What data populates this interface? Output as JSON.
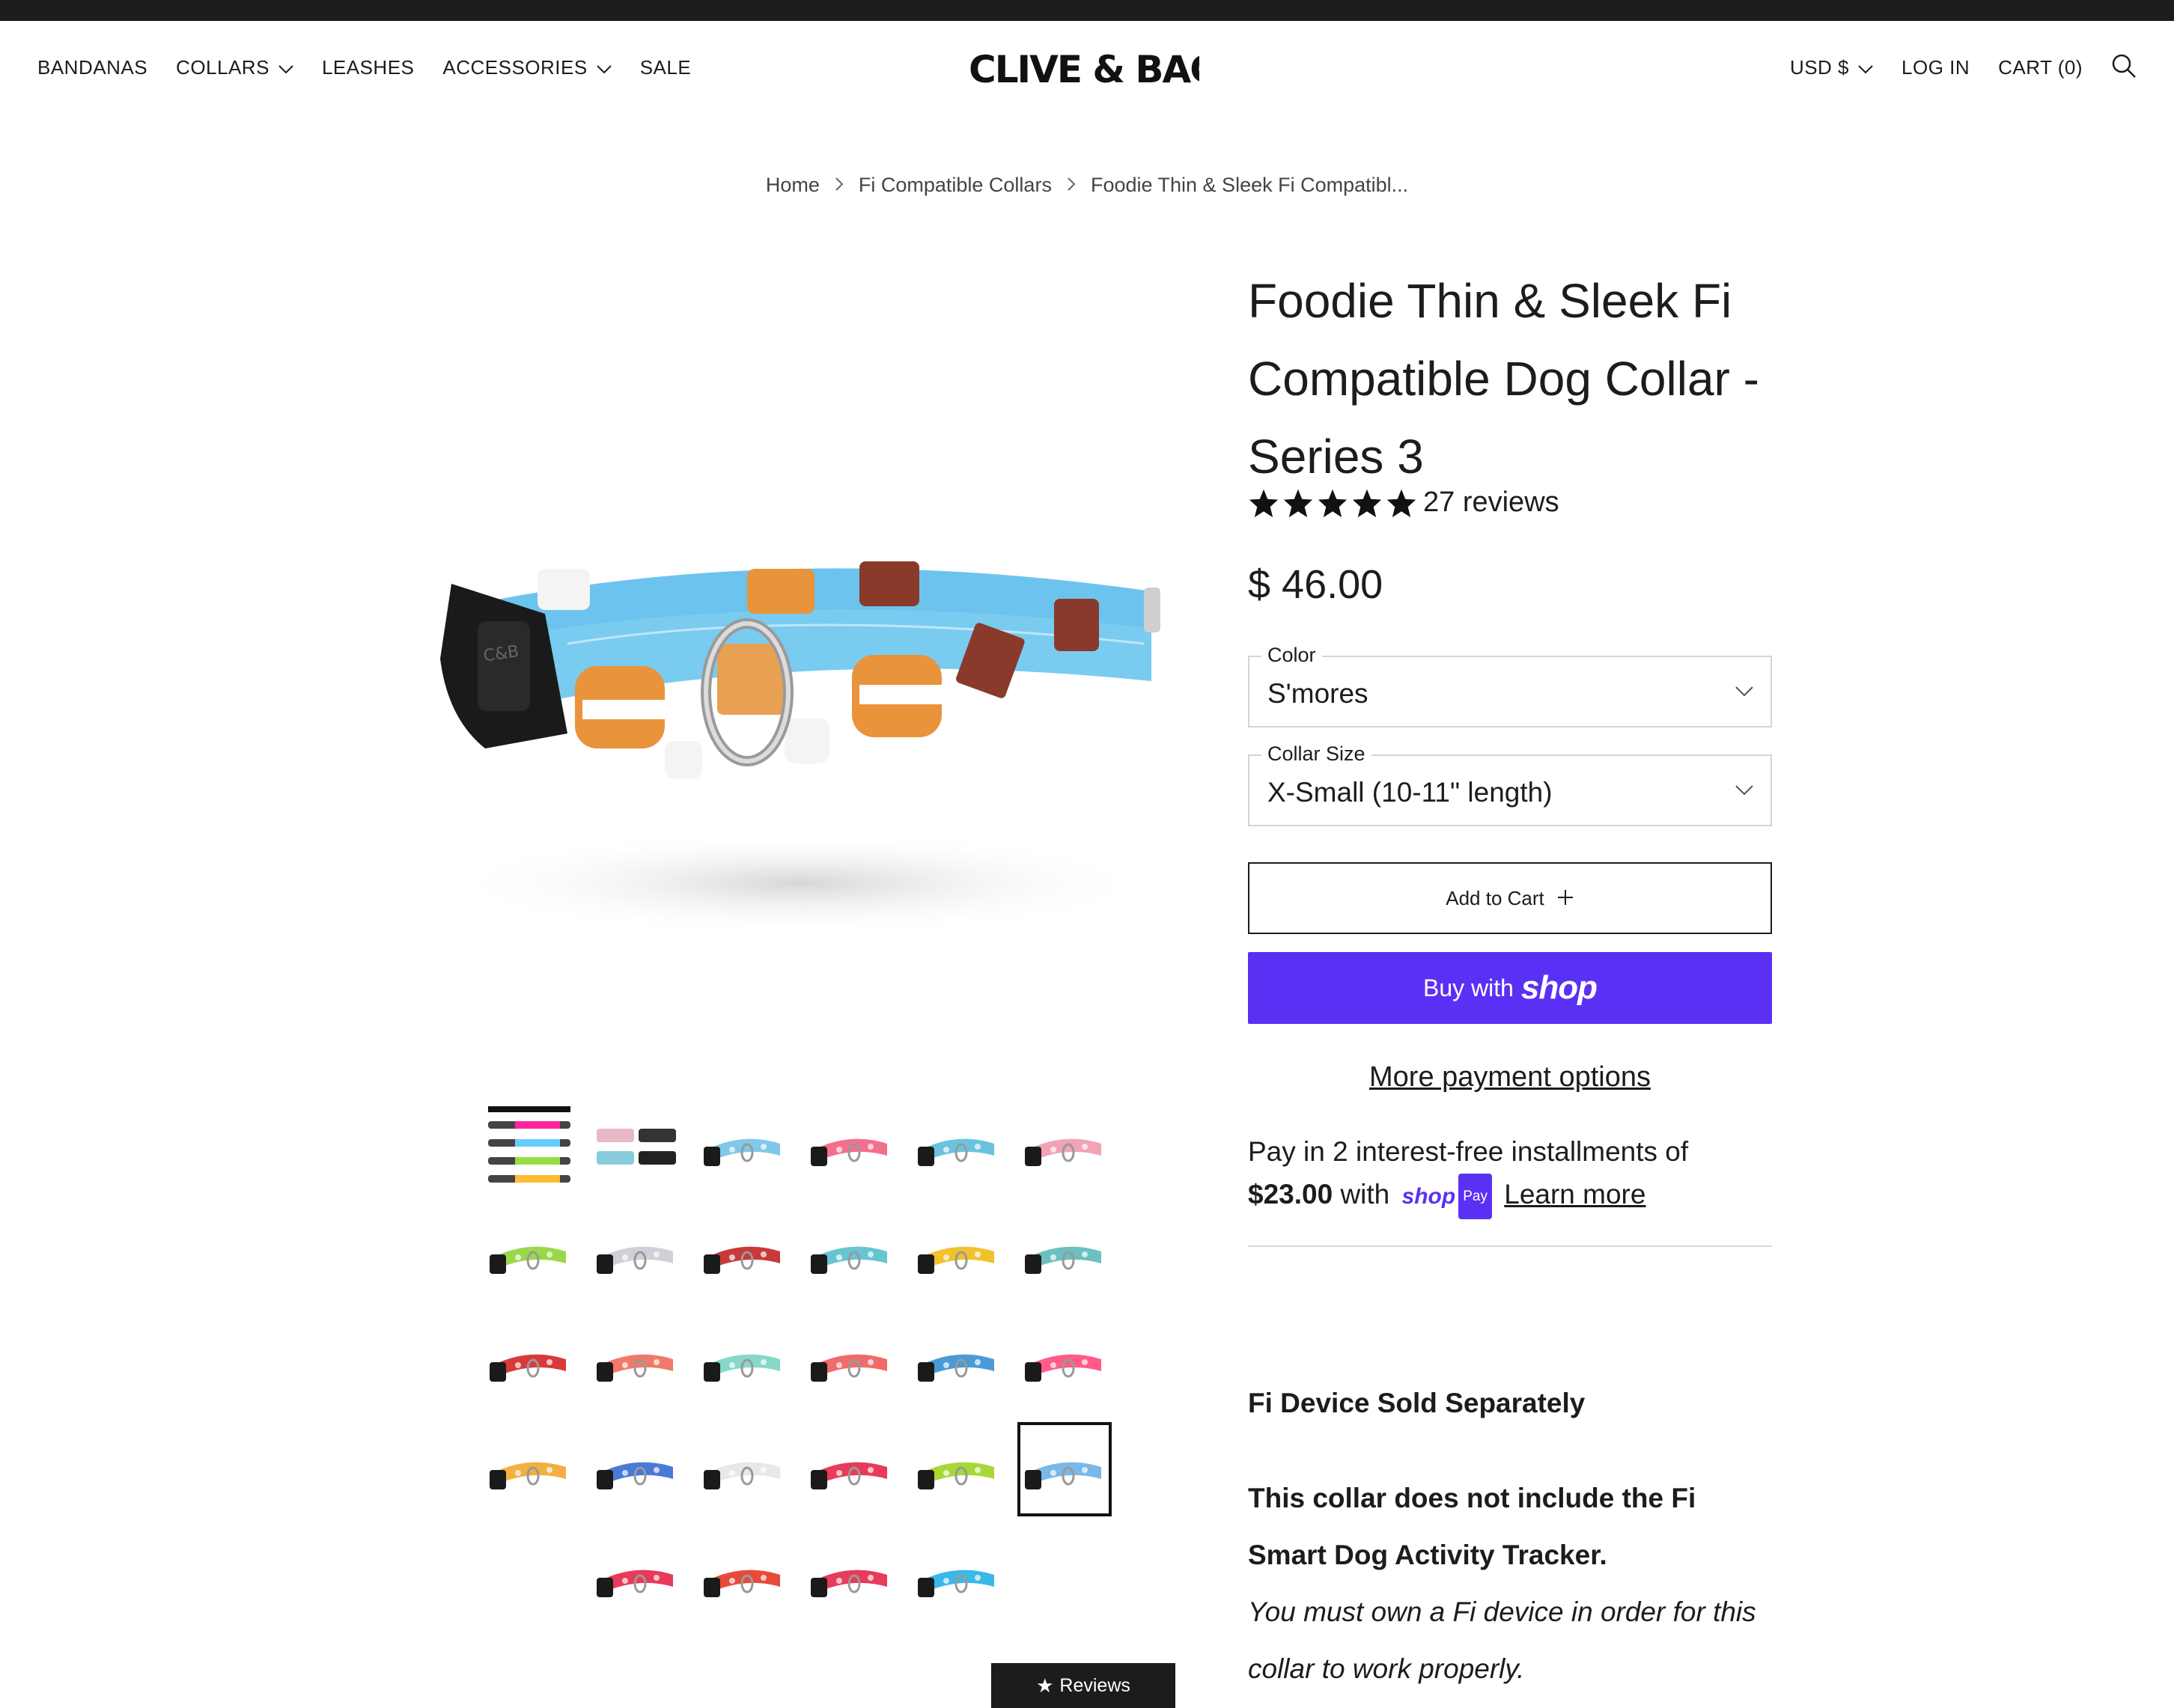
{
  "header": {
    "nav_left": [
      {
        "label": "BANDANAS",
        "has_dropdown": false
      },
      {
        "label": "COLLARS",
        "has_dropdown": true
      },
      {
        "label": "LEASHES",
        "has_dropdown": false
      },
      {
        "label": "ACCESSORIES",
        "has_dropdown": true
      },
      {
        "label": "SALE",
        "has_dropdown": false
      }
    ],
    "logo_text": "CLIVE & BACON",
    "currency": "USD $",
    "login": "LOG IN",
    "cart": "CART (0)"
  },
  "breadcrumb": [
    "Home",
    "Fi Compatible Collars",
    "Foodie Thin & Sleek Fi Compatibl..."
  ],
  "product": {
    "title": "Foodie Thin & Sleek Fi Compatible Dog Collar - Series 3",
    "rating_stars": 5,
    "reviews_text": "27 reviews",
    "price": "$ 46.00",
    "color_label": "Color",
    "color_value": "S'mores",
    "size_label": "Collar Size",
    "size_value": "X-Small (10-11\" length)",
    "add_to_cart": "Add to Cart",
    "buy_with": "Buy with",
    "buy_shop": "shop",
    "more_payment": "More payment options",
    "installments_text": "Pay in 2 interest-free installments of",
    "installment_amount": "$23.00",
    "installments_with": "with",
    "shop_pay_shop": "shop",
    "shop_pay_pay": "Pay",
    "learn_more": "Learn more",
    "desc_heading": "Fi Device Sold Separately",
    "desc_bold": "This collar does not include the Fi Smart Dog Activity Tracker.",
    "desc_italic": "You must own a Fi device in order for this collar to work properly."
  },
  "thumbnails": {
    "selected_index": 23,
    "colors": [
      "#222222",
      "#555555",
      "#7fc8e8",
      "#f2708c",
      "#69c3df",
      "#f2a3b5",
      "#9ad84a",
      "#d0d0d8",
      "#c83a3a",
      "#67c5d2",
      "#f2c12e",
      "#6bc0c0",
      "#d83a3a",
      "#f07a6a",
      "#86d8c8",
      "#f26a6a",
      "#4a9ad8",
      "#ff5a8a",
      "#f2b040",
      "#4a7ad8",
      "#e8e8e8",
      "#e83a5a",
      "#a8d838",
      "#7ab8e8",
      "#e83a5a",
      "#e84a3a",
      "#e83a5a",
      "#3ab8e8"
    ]
  },
  "reviews_tab": "Reviews",
  "colors": {
    "topbar": "#1c1c1c",
    "shop_purple": "#5a31f4",
    "text": "#1c1c1c"
  }
}
